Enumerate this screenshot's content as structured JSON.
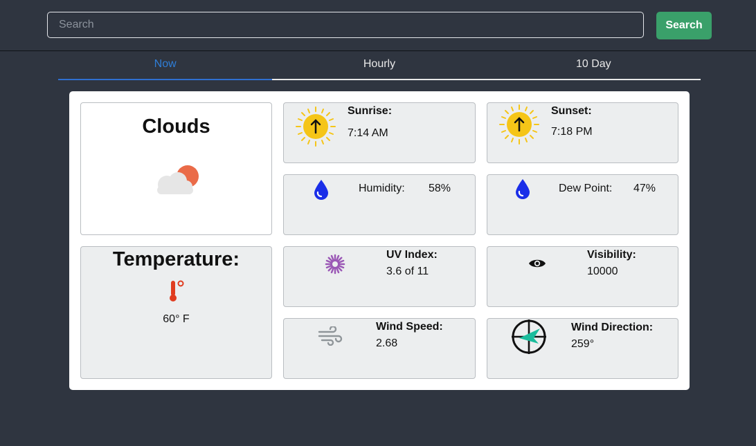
{
  "search": {
    "placeholder": "Search",
    "button_label": "Search"
  },
  "tabs": [
    {
      "label": "Now"
    },
    {
      "label": "Hourly"
    },
    {
      "label": "10 Day"
    }
  ],
  "weather": {
    "condition": "Clouds",
    "temperature_label": "Temperature:",
    "temperature_value": "60° F",
    "sunrise": {
      "label": "Sunrise:",
      "value": "7:14 AM"
    },
    "sunset": {
      "label": "Sunset:",
      "value": "7:18 PM"
    },
    "humidity": {
      "label": "Humidity:",
      "value": "58%"
    },
    "dew_point": {
      "label": "Dew Point:",
      "value": "47%"
    },
    "uv_index": {
      "label": "UV Index:",
      "value": "3.6 of 11"
    },
    "visibility": {
      "label": "Visibility:",
      "value": "10000"
    },
    "wind_speed": {
      "label": "Wind Speed:",
      "value": "2.68"
    },
    "wind_direction": {
      "label": "Wind Direction:",
      "value": "259°"
    }
  },
  "icons": {
    "sunrise": "sun-arrow-up-icon",
    "sunset": "sun-arrow-up-icon",
    "humidity": "water-drop-icon",
    "dew_point": "water-drop-icon",
    "uv_index": "uv-sun-icon",
    "visibility": "eye-icon",
    "wind_speed": "wind-icon",
    "wind_direction": "compass-icon",
    "condition": "cloud-sun-icon",
    "temperature": "thermometer-icon"
  },
  "colors": {
    "background": "#2f3540",
    "accent_tab": "#2f7ed8",
    "search_button": "#3aa06a",
    "sun": "#f5c518",
    "drop": "#1a2ee8",
    "uv": "#9b59b6",
    "compass_arrow": "#1abc9c",
    "thermometer": "#e03c1f",
    "cloud_sun": "#ea6b48"
  }
}
